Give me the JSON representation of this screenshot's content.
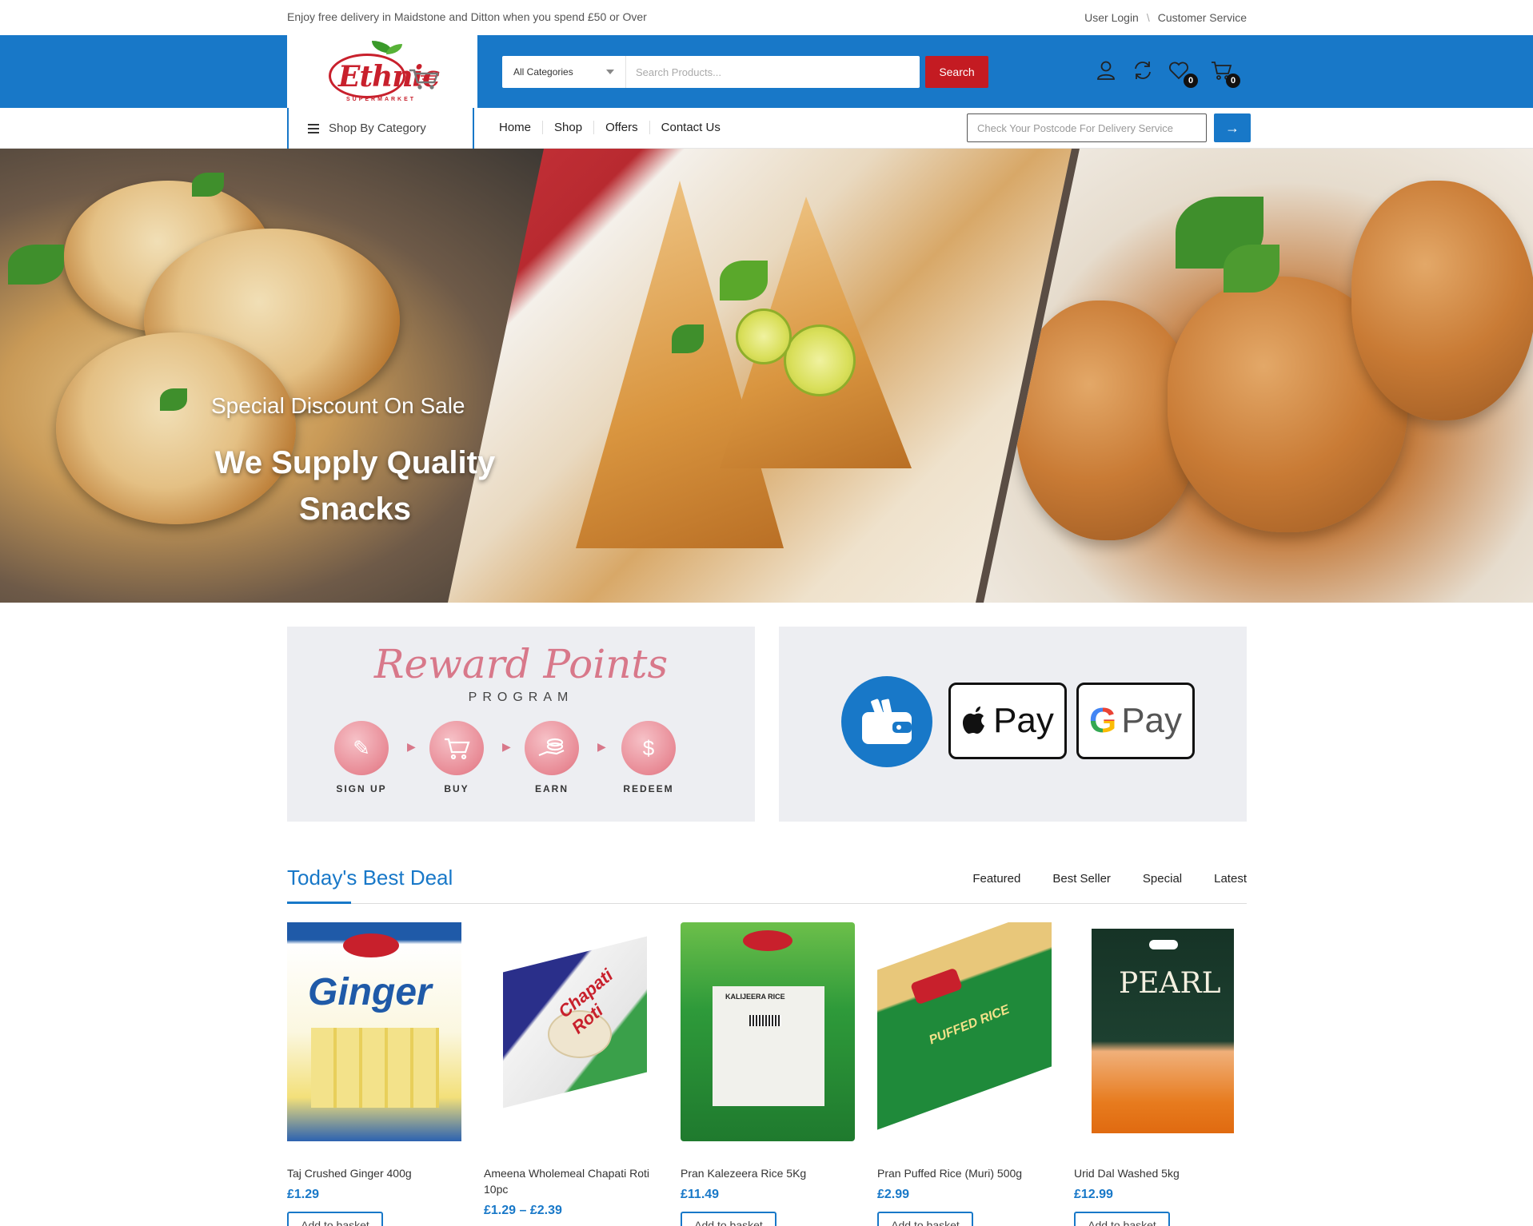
{
  "topbar": {
    "promo": "Enjoy free delivery in Maidstone and Ditton when you spend £50 or Over",
    "user_login": "User Login",
    "separator": "\\",
    "customer_service": "Customer Service"
  },
  "logo": {
    "brand": "Ethnic",
    "tagline": "SUPERMARKET"
  },
  "search": {
    "category": "All Categories",
    "placeholder": "Search Products...",
    "button": "Search"
  },
  "header_icons": {
    "wishlist_count": "0",
    "cart_count": "0"
  },
  "nav": {
    "shop_by_category": "Shop By Category",
    "items": [
      "Home",
      "Shop",
      "Offers",
      "Contact Us"
    ],
    "postcode_placeholder": "Check Your Postcode For Delivery Service",
    "postcode_button": "→"
  },
  "hero": {
    "subtitle": "Special Discount On Sale",
    "title": "We Supply Quality Snacks"
  },
  "reward": {
    "title": "Reward Points",
    "subtitle": "PROGRAM",
    "steps": [
      "SIGN UP",
      "BUY",
      "EARN",
      "REDEEM"
    ]
  },
  "payments": {
    "apple_pay": "Pay",
    "google_pay_g": "G",
    "google_pay": "Pay"
  },
  "deals": {
    "title": "Today's Best Deal",
    "tabs": [
      "Featured",
      "Best Seller",
      "Special",
      "Latest"
    ],
    "add_label": "Add to basket",
    "products": [
      {
        "name": "Taj Crushed Ginger 400g",
        "price": "£1.29",
        "pack_text": "Ginger"
      },
      {
        "name": "Ameena Wholemeal Chapati Roti 10pc",
        "price": "£1.29 – £2.39",
        "pack_text": "Chapati Roti"
      },
      {
        "name": "Pran Kalezeera Rice 5Kg",
        "price": "£11.49",
        "pack_text": "KALIJEERA RICE"
      },
      {
        "name": "Pran Puffed Rice (Muri) 500g",
        "price": "£2.99",
        "pack_text": "PUFFED RICE"
      },
      {
        "name": "Urid Dal Washed 5kg",
        "price": "£12.99",
        "pack_text": "PEARL"
      }
    ]
  },
  "colors": {
    "brand_blue": "#1878c8",
    "search_red": "#c41b22",
    "reward_pink": "#d8788a"
  }
}
